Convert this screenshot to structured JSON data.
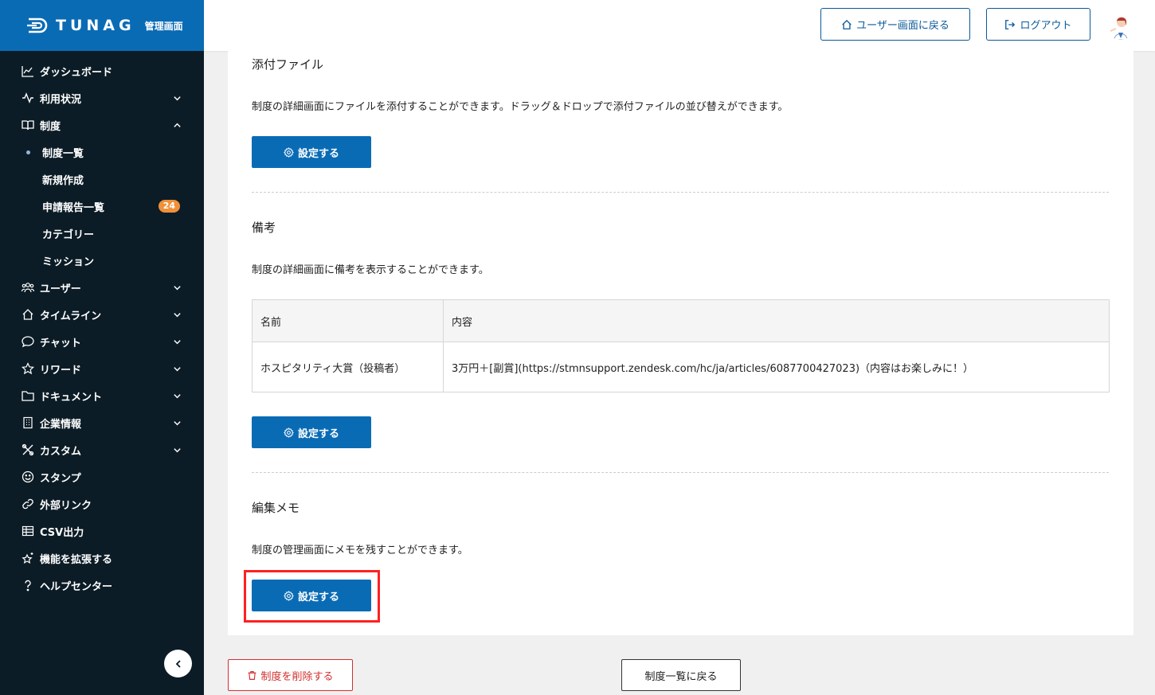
{
  "brand": {
    "name": "TUNAG",
    "sub": "管理画面"
  },
  "sidebar": {
    "items": [
      {
        "label": "ダッシュボード",
        "icon": "chart-line-icon"
      },
      {
        "label": "利用状況",
        "icon": "activity-icon"
      },
      {
        "label": "制度",
        "icon": "book-icon"
      },
      {
        "label": "ユーザー",
        "icon": "users-icon"
      },
      {
        "label": "タイムライン",
        "icon": "home-icon"
      },
      {
        "label": "チャット",
        "icon": "chat-bubble-icon"
      },
      {
        "label": "リワード",
        "icon": "star-icon"
      },
      {
        "label": "ドキュメント",
        "icon": "folder-icon"
      },
      {
        "label": "企業情報",
        "icon": "building-icon"
      },
      {
        "label": "カスタム",
        "icon": "tools-icon"
      },
      {
        "label": "スタンプ",
        "icon": "smile-icon"
      },
      {
        "label": "外部リンク",
        "icon": "link-icon"
      },
      {
        "label": "CSV出力",
        "icon": "table-icon"
      },
      {
        "label": "機能を拡張する",
        "icon": "sparkle-star-icon"
      },
      {
        "label": "ヘルプセンター",
        "icon": "question-icon"
      }
    ],
    "sub_items": [
      {
        "label": "制度一覧"
      },
      {
        "label": "新規作成"
      },
      {
        "label": "申請報告一覧",
        "badge": "24"
      },
      {
        "label": "カテゴリー"
      },
      {
        "label": "ミッション"
      }
    ]
  },
  "header": {
    "user_screen_label": "ユーザー画面に戻る",
    "logout_label": "ログアウト"
  },
  "sections": {
    "attachments": {
      "title": "添付ファイル",
      "description": "制度の詳細画面にファイルを添付することができます。ドラッグ＆ドロップで添付ファイルの並び替えができます。",
      "button": "設定する"
    },
    "notes": {
      "title": "備考",
      "description": "制度の詳細画面に備考を表示することができます。",
      "table": {
        "headers": [
          "名前",
          "内容"
        ],
        "rows": [
          [
            "ホスピタリティ大賞（投稿者）",
            "3万円＋[副賞](https://stmnsupport.zendesk.com/hc/ja/articles/6087700427023)（内容はお楽しみに！）"
          ]
        ]
      },
      "button": "設定する"
    },
    "memo": {
      "title": "編集メモ",
      "description": "制度の管理画面にメモを残すことができます。",
      "button": "設定する"
    }
  },
  "footer": {
    "delete_label": "制度を削除する",
    "back_label": "制度一覧に戻る"
  },
  "colors": {
    "brand": "#0a6bb5",
    "sidebar_bg": "#0c1c26",
    "badge": "#f0903a",
    "danger": "#d32f2f",
    "highlight": "#ff2020"
  }
}
